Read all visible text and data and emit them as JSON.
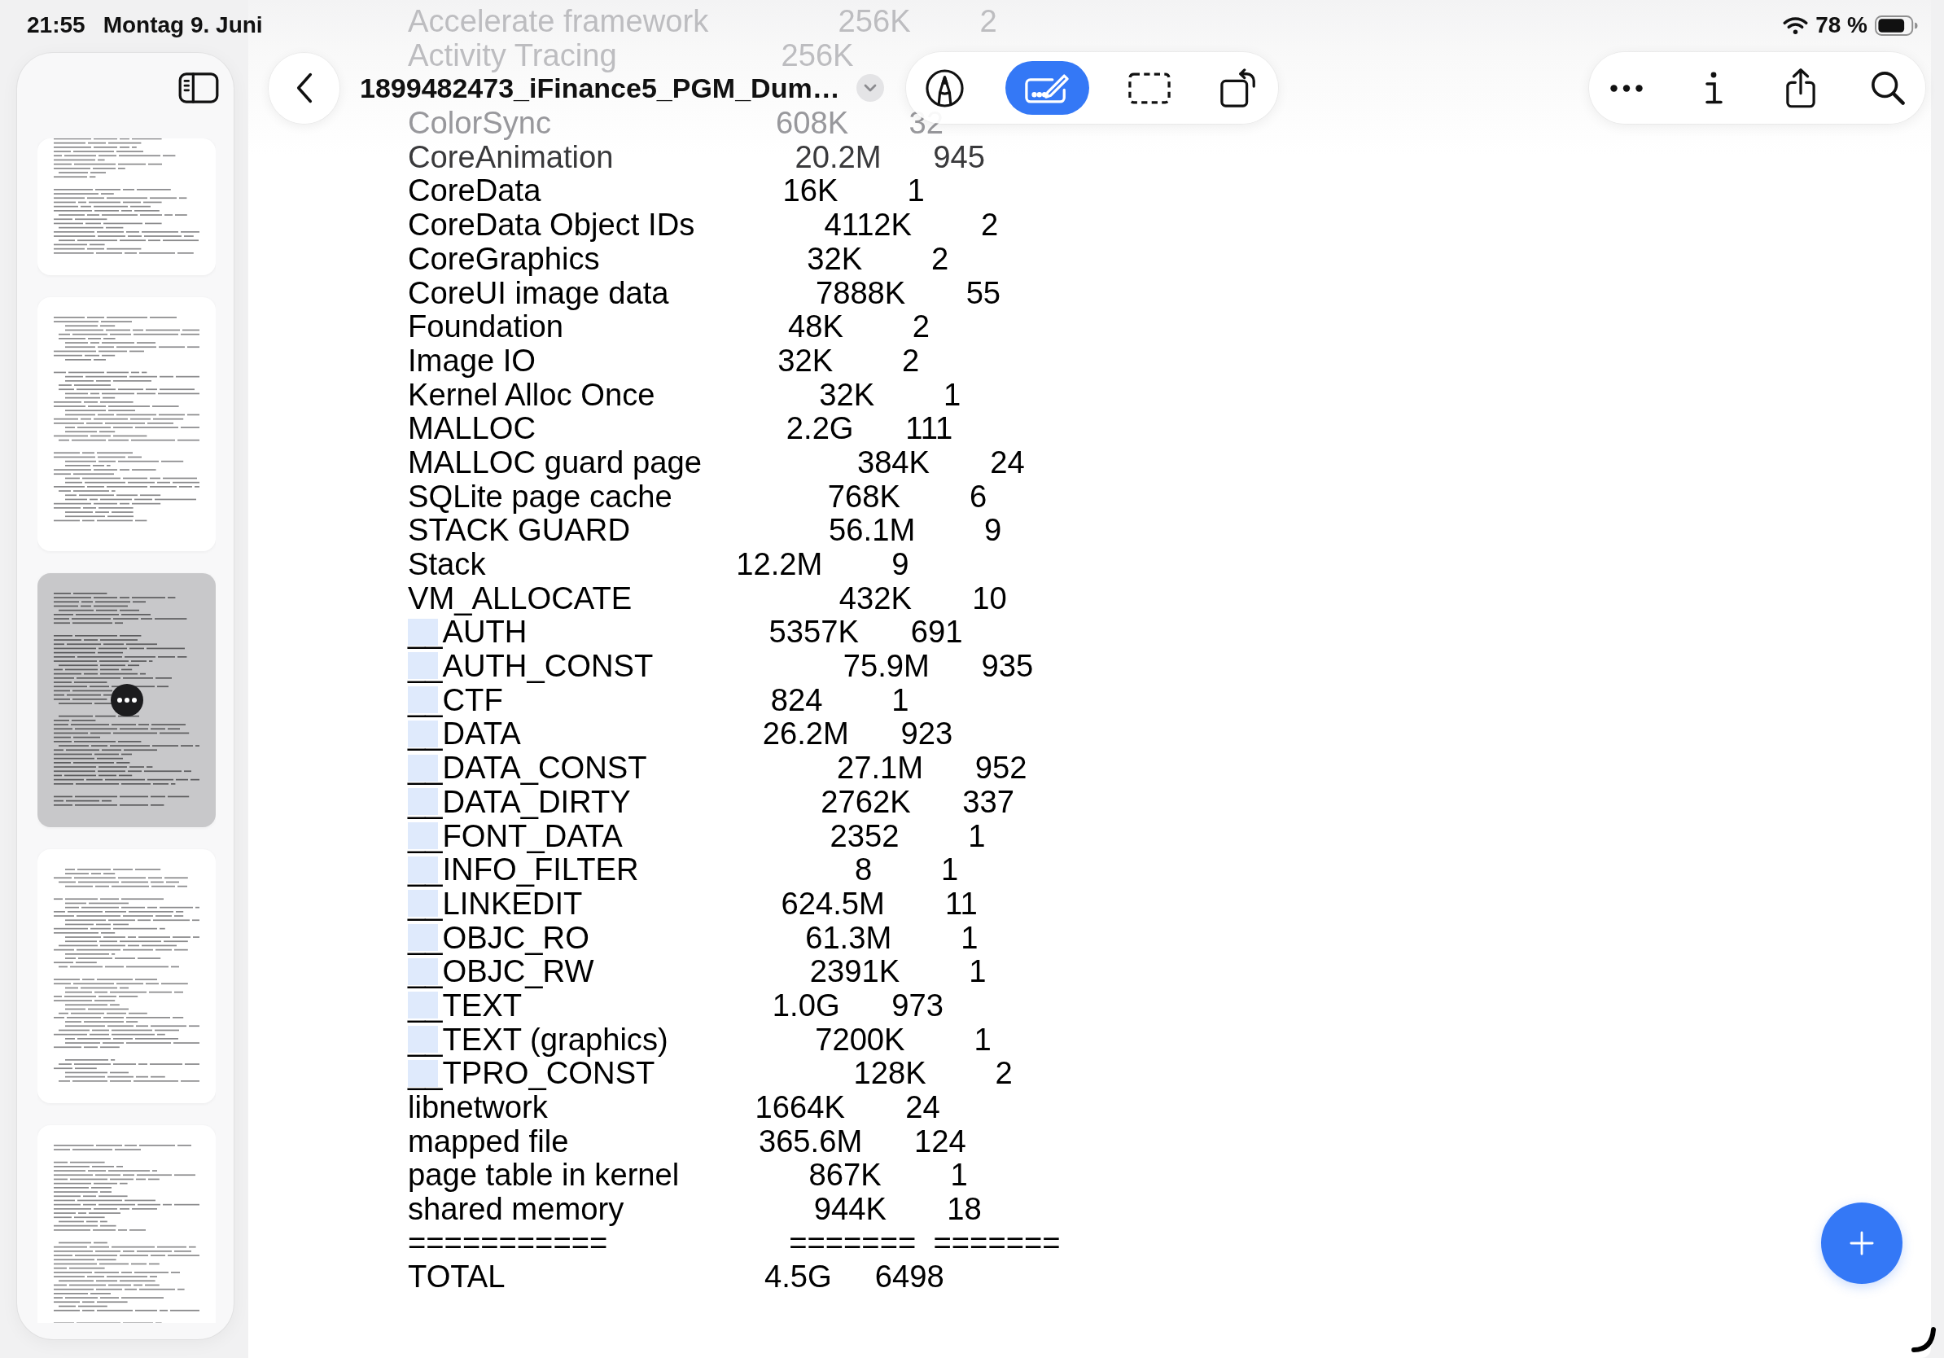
{
  "status_bar": {
    "time": "21:55",
    "date": "Montag 9. Juni",
    "battery_percent": "78 %"
  },
  "sidebar": {
    "thumbnails": [
      {
        "selected": false
      },
      {
        "selected": false
      },
      {
        "selected": true
      },
      {
        "selected": false
      },
      {
        "selected": false
      }
    ]
  },
  "toolbar": {
    "title": "1899482473_iFinance5_PGM_Dum…",
    "tools": [
      {
        "kind": "markup",
        "selected": false
      },
      {
        "kind": "text_input",
        "selected": true
      },
      {
        "kind": "selection",
        "selected": false
      },
      {
        "kind": "rotate",
        "selected": false
      }
    ],
    "actions": [
      {
        "kind": "more"
      },
      {
        "kind": "info"
      },
      {
        "kind": "share"
      },
      {
        "kind": "search"
      }
    ]
  },
  "document": {
    "rows_under_toolbar": [
      {
        "label": "Accelerate framework",
        "size": "256K",
        "count": "2"
      },
      {
        "label": "Activity Tracing",
        "size": "256K"
      }
    ],
    "rows": [
      {
        "label": "ColorSync",
        "size": "608K",
        "count": "32",
        "highlighted": false
      },
      {
        "label": "CoreAnimation",
        "size": "20.2M",
        "count": "945",
        "highlighted": false
      },
      {
        "label": "CoreData",
        "size": "16K",
        "count": "1",
        "highlighted": false
      },
      {
        "label": "CoreData Object IDs",
        "size": "4112K",
        "count": "2",
        "highlighted": false
      },
      {
        "label": "CoreGraphics",
        "size": "32K",
        "count": "2",
        "highlighted": false
      },
      {
        "label": "CoreUI image data",
        "size": "7888K",
        "count": "55",
        "highlighted": false
      },
      {
        "label": "Foundation",
        "size": "48K",
        "count": "2",
        "highlighted": false
      },
      {
        "label": "Image IO",
        "size": "32K",
        "count": "2",
        "highlighted": false
      },
      {
        "label": "Kernel Alloc Once",
        "size": "32K",
        "count": "1",
        "highlighted": false
      },
      {
        "label": "MALLOC",
        "size": "2.2G",
        "count": "111",
        "highlighted": false
      },
      {
        "label": "MALLOC guard page",
        "size": "384K",
        "count": "24",
        "highlighted": false
      },
      {
        "label": "SQLite page cache",
        "size": "768K",
        "count": "6",
        "highlighted": false
      },
      {
        "label": "STACK GUARD",
        "size": "56.1M",
        "count": "9",
        "highlighted": false
      },
      {
        "label": "Stack",
        "size": "12.2M",
        "count": "9",
        "highlighted": false
      },
      {
        "label": "VM_ALLOCATE",
        "size": "432K",
        "count": "10",
        "highlighted": false
      },
      {
        "label": "__AUTH",
        "size": "5357K",
        "count": "691",
        "highlighted": true
      },
      {
        "label": "__AUTH_CONST",
        "size": "75.9M",
        "count": "935",
        "highlighted": true
      },
      {
        "label": "__CTF",
        "size": "824",
        "count": "1",
        "highlighted": true
      },
      {
        "label": "__DATA",
        "size": "26.2M",
        "count": "923",
        "highlighted": true
      },
      {
        "label": "__DATA_CONST",
        "size": "27.1M",
        "count": "952",
        "highlighted": true
      },
      {
        "label": "__DATA_DIRTY",
        "size": "2762K",
        "count": "337",
        "highlighted": true
      },
      {
        "label": "__FONT_DATA",
        "size": "2352",
        "count": "1",
        "highlighted": true
      },
      {
        "label": "__INFO_FILTER",
        "size": "8",
        "count": "1",
        "highlighted": true
      },
      {
        "label": "__LINKEDIT",
        "size": "624.5M",
        "count": "11",
        "highlighted": true
      },
      {
        "label": "__OBJC_RO",
        "size": "61.3M",
        "count": "1",
        "highlighted": true
      },
      {
        "label": "__OBJC_RW",
        "size": "2391K",
        "count": "1",
        "highlighted": true
      },
      {
        "label": "__TEXT",
        "size": "1.0G",
        "count": "973",
        "highlighted": true
      },
      {
        "label": "__TEXT (graphics)",
        "size": "7200K",
        "count": "1",
        "highlighted": true
      },
      {
        "label": "__TPRO_CONST",
        "size": "128K",
        "count": "2",
        "highlighted": true
      },
      {
        "label": "libnetwork",
        "size": "1664K",
        "count": "24",
        "highlighted": false
      },
      {
        "label": "mapped file",
        "size": "365.6M",
        "count": "124",
        "highlighted": false
      },
      {
        "label": "page table in kernel",
        "size": "867K",
        "count": "1",
        "highlighted": false
      },
      {
        "label": "shared memory",
        "size": "944K",
        "count": "18",
        "highlighted": false
      },
      {
        "label": "===========",
        "size": "=======",
        "count": "=======",
        "highlighted": false
      },
      {
        "label": "TOTAL",
        "size": "4.5G",
        "count": "6498",
        "highlighted": false
      }
    ]
  }
}
